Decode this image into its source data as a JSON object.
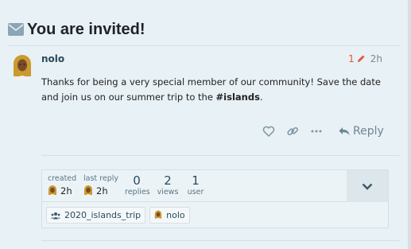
{
  "topic": {
    "title": "You are invited!"
  },
  "post": {
    "username": "nolo",
    "edit_count": "1",
    "age": "2h",
    "body_before": "Thanks for being a very special member of our community! Save the date and join us on our summer trip to the ",
    "body_hashtag": "#islands",
    "body_after": ".",
    "reply_label": "Reply"
  },
  "summary": {
    "created_label": "created",
    "created_age": "2h",
    "last_reply_label": "last reply",
    "last_reply_age": "2h",
    "replies_count": "0",
    "replies_label": "replies",
    "views_count": "2",
    "views_label": "views",
    "users_count": "1",
    "users_label": "user",
    "group_tag": "2020_islands_trip",
    "user_tag": "nolo"
  },
  "colors": {
    "accent": "#e45735",
    "link": "#2b4a5a",
    "muted": "#6f8794"
  }
}
